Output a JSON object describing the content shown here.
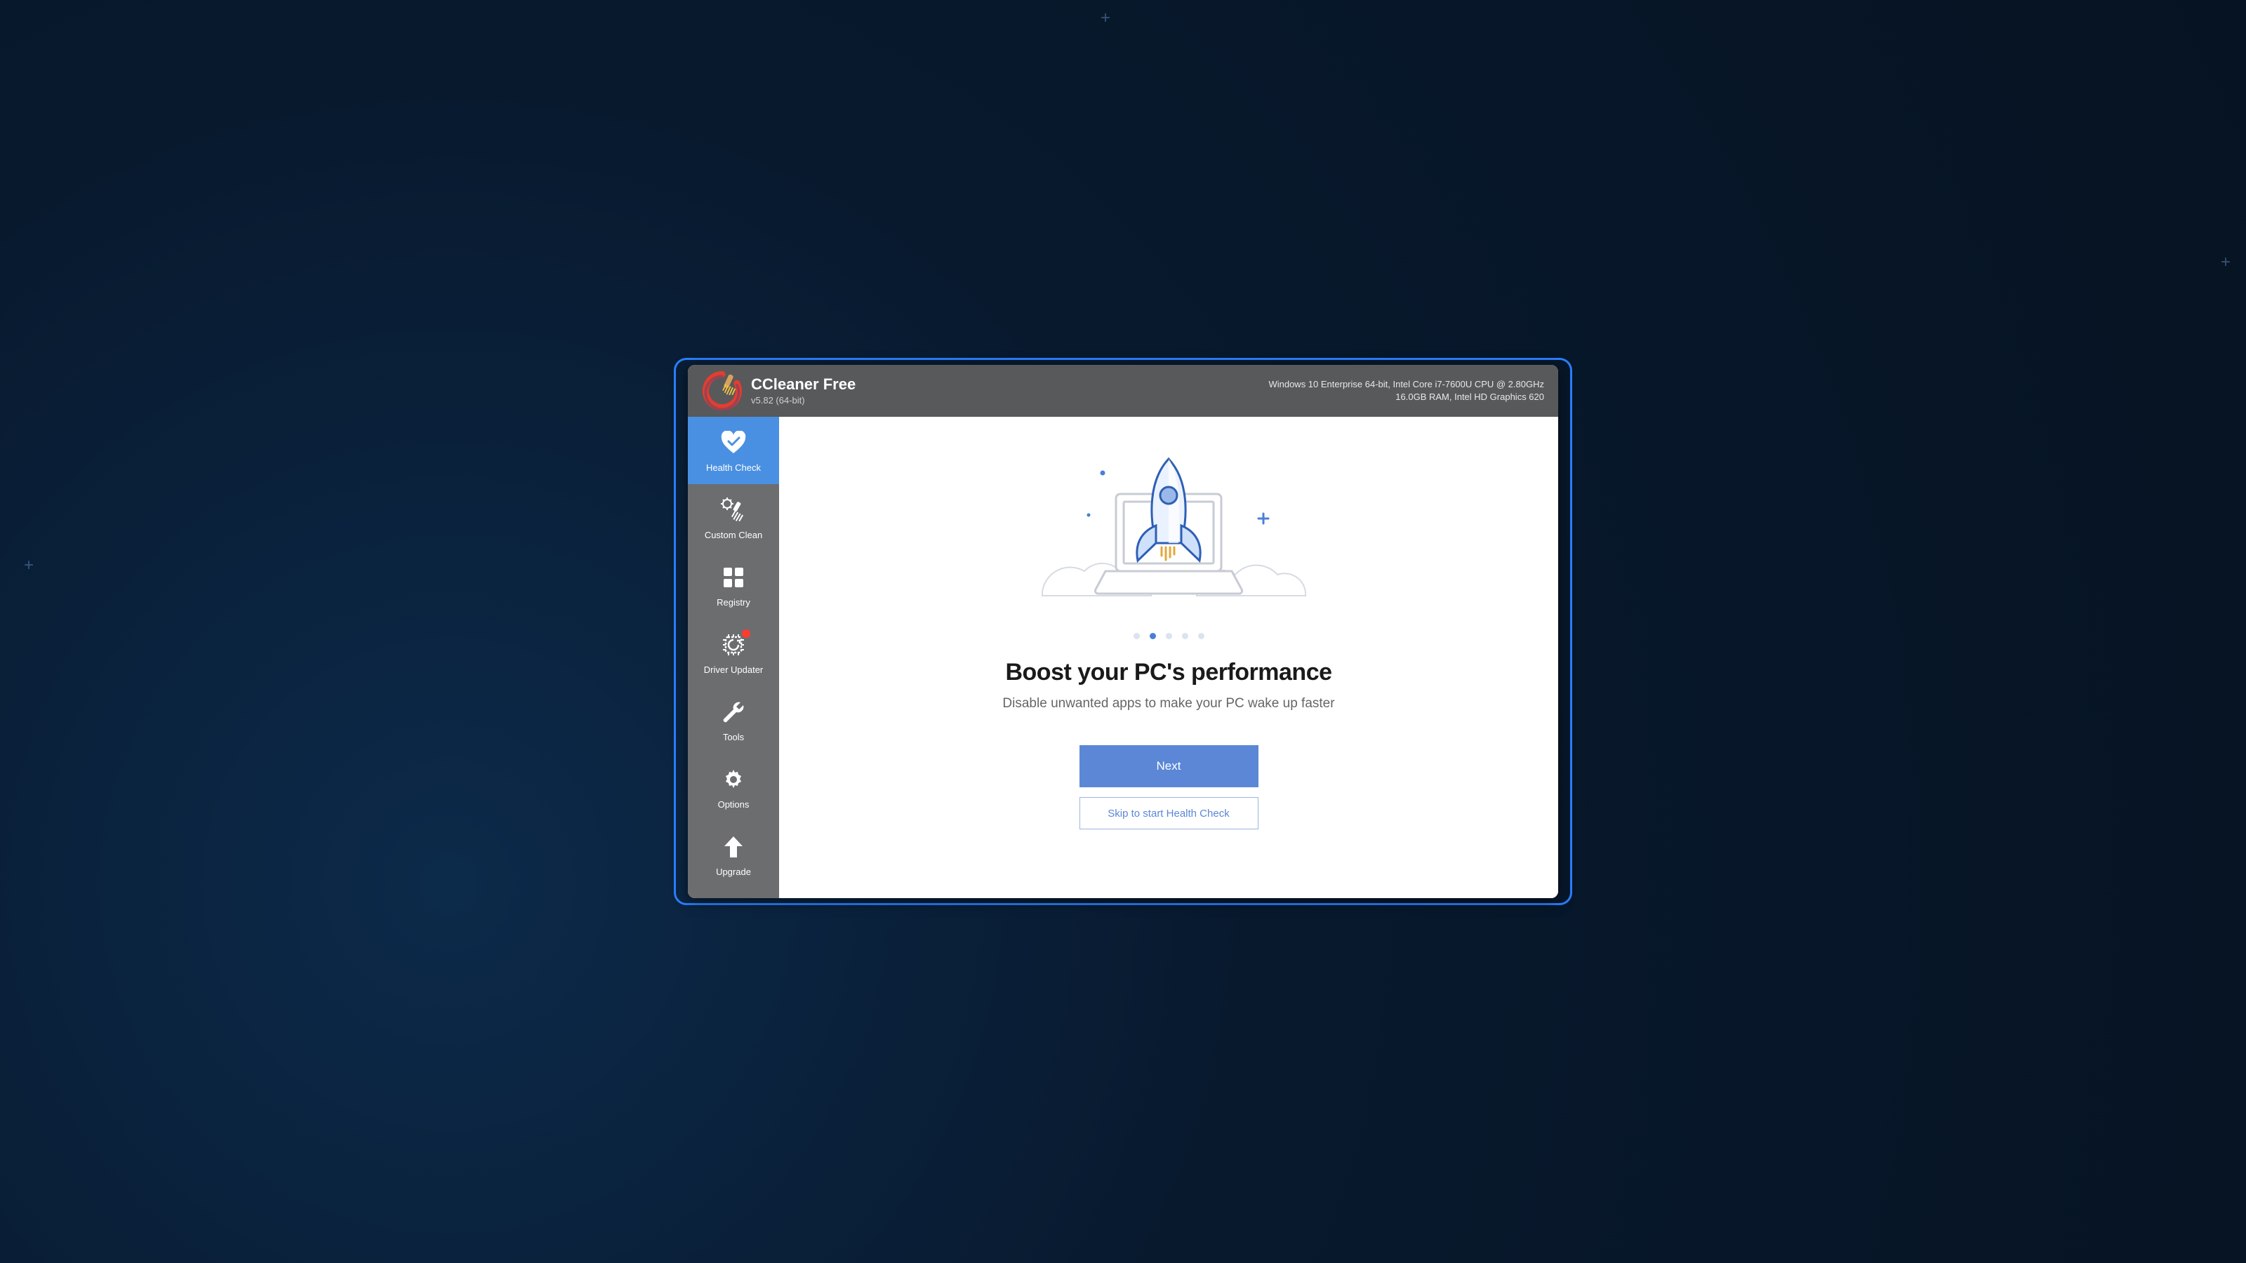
{
  "header": {
    "app_name": "CCleaner Free",
    "version": "v5.82 (64-bit)",
    "sysinfo_line1": "Windows 10 Enterprise 64-bit, Intel Core i7-7600U CPU @ 2.80GHz",
    "sysinfo_line2": "16.0GB RAM, Intel HD Graphics 620"
  },
  "sidebar": {
    "items": [
      {
        "label": "Health Check",
        "icon": "heart-check-icon",
        "active": true,
        "notification": false
      },
      {
        "label": "Custom Clean",
        "icon": "brush-gear-icon",
        "active": false,
        "notification": false
      },
      {
        "label": "Registry",
        "icon": "grid-icon",
        "active": false,
        "notification": false
      },
      {
        "label": "Driver Updater",
        "icon": "chip-icon",
        "active": false,
        "notification": true
      },
      {
        "label": "Tools",
        "icon": "wrench-icon",
        "active": false,
        "notification": false
      },
      {
        "label": "Options",
        "icon": "gear-icon",
        "active": false,
        "notification": false
      },
      {
        "label": "Upgrade",
        "icon": "arrow-up-icon",
        "active": false,
        "notification": false
      }
    ]
  },
  "main": {
    "pager": {
      "total": 5,
      "active_index": 1
    },
    "headline": "Boost your PC's performance",
    "subhead": "Disable unwanted apps to make your PC wake up faster",
    "primary_button": "Next",
    "secondary_button": "Skip to start Health Check"
  },
  "colors": {
    "accent": "#4a90e2",
    "button_primary": "#5b87d6",
    "notification": "#ff3b30"
  }
}
